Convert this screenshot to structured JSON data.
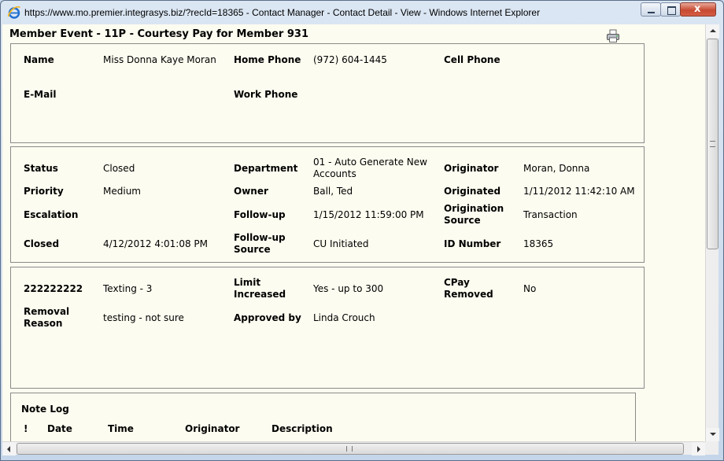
{
  "window": {
    "title": "https://www.mo.premier.integrasys.biz/?recId=18365 - Contact Manager - Contact Detail - View - Windows Internet Explorer",
    "close_glyph": "x"
  },
  "page": {
    "title": "Member Event - 11P - Courtesy Pay for Member 931",
    "print_icon": "printer-icon"
  },
  "contact": {
    "name_label": "Name",
    "name": "Miss Donna Kaye Moran",
    "home_phone_label": "Home Phone",
    "home_phone": "(972) 604-1445",
    "cell_phone_label": "Cell Phone",
    "cell_phone": "",
    "email_label": "E-Mail",
    "email": "",
    "work_phone_label": "Work Phone",
    "work_phone": ""
  },
  "event": {
    "status_label": "Status",
    "status": "Closed",
    "department_label": "Department",
    "department_line1": "01 - Auto Generate New",
    "department_line2": "Accounts",
    "originator_label": "Originator",
    "originator": "Moran, Donna",
    "priority_label": "Priority",
    "priority": "Medium",
    "owner_label": "Owner",
    "owner": "Ball, Ted",
    "originated_label": "Originated",
    "originated": "1/11/2012 11:42:10 AM",
    "escalation_label": "Escalation",
    "escalation": "",
    "followup_label": "Follow-up",
    "followup": "1/15/2012 11:59:00 PM",
    "orig_source_label_1": "Origination",
    "orig_source_label_2": "Source",
    "orig_source": "Transaction",
    "closed_label": "Closed",
    "closed": "4/12/2012 4:01:08 PM",
    "followup_source_label_1": "Follow-up",
    "followup_source_label_2": "Source",
    "followup_source": "CU Initiated",
    "id_label": "ID Number",
    "id": "18365"
  },
  "custom": {
    "field1_label": "222222222",
    "field1": "Texting - 3",
    "limit_label_1": "Limit",
    "limit_label_2": "Increased",
    "limit": "Yes - up to 300",
    "cpay_label_1": "CPay",
    "cpay_label_2": "Removed",
    "cpay": "No",
    "removal_label_1": "Removal",
    "removal_label_2": "Reason",
    "removal": "testing - not sure",
    "approved_label": "Approved by",
    "approved": "Linda Crouch"
  },
  "note_log": {
    "title": "Note Log",
    "columns": [
      "!",
      "Date",
      "Time",
      "Originator",
      "Description"
    ]
  }
}
